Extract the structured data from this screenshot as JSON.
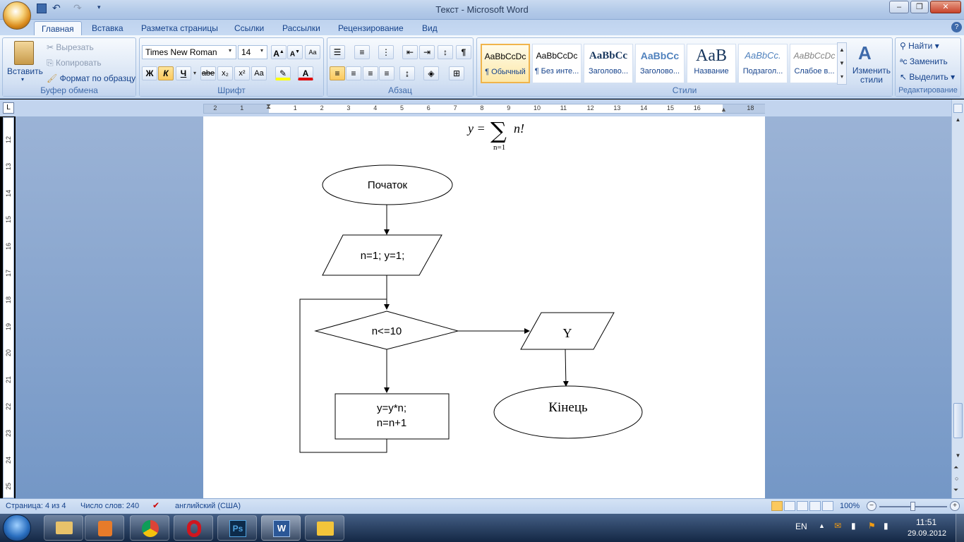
{
  "window": {
    "title": "Текст - Microsoft Word"
  },
  "tabs": [
    "Главная",
    "Вставка",
    "Разметка страницы",
    "Ссылки",
    "Рассылки",
    "Рецензирование",
    "Вид"
  ],
  "clipboard": {
    "paste": "Вставить",
    "cut": "Вырезать",
    "copy": "Копировать",
    "format": "Формат по образцу",
    "label": "Буфер обмена"
  },
  "font": {
    "name": "Times New Roman",
    "size": "14",
    "label": "Шрифт",
    "bold": "Ж",
    "italic": "К",
    "underline": "Ч",
    "strike": "abe",
    "sub": "x₂",
    "sup": "x²",
    "case": "Aa"
  },
  "paragraph": {
    "label": "Абзац"
  },
  "styles": {
    "label": "Стили",
    "items": [
      {
        "sample": "AaBbCcDc",
        "name": "¶ Обычный"
      },
      {
        "sample": "AaBbCcDc",
        "name": "¶ Без инте..."
      },
      {
        "sample": "AaBbCc",
        "name": "Заголово..."
      },
      {
        "sample": "AaBbCc",
        "name": "Заголово..."
      },
      {
        "sample": "AaB",
        "name": "Название"
      },
      {
        "sample": "AaBbCc.",
        "name": "Подзагол..."
      },
      {
        "sample": "AaBbCcDc",
        "name": "Слабое в..."
      }
    ],
    "change": "Изменить стили"
  },
  "editing": {
    "label": "Редактирование",
    "find": "Найти",
    "replace": "Заменить",
    "select": "Выделить"
  },
  "ruler": {
    "ticks": [
      "2",
      "1",
      "1",
      "2",
      "3",
      "4",
      "5",
      "6",
      "7",
      "8",
      "9",
      "10",
      "11",
      "12",
      "13",
      "14",
      "15",
      "16",
      "18"
    ],
    "vticks": [
      "12",
      "13",
      "14",
      "15",
      "16",
      "17",
      "18",
      "19",
      "20",
      "21",
      "22",
      "23",
      "24",
      "25"
    ]
  },
  "formula": {
    "lhs": "y =",
    "sum": "∑",
    "rhs": "n!",
    "sub": "n=1"
  },
  "flowchart": {
    "start": "Початок",
    "input": "n=1; y=1;",
    "cond": "n<=10",
    "process_line1": "y=y*n;",
    "process_line2": "n=n+1",
    "output": "Y",
    "end": "Кінець"
  },
  "status": {
    "page": "Страница: 4 из 4",
    "words": "Число слов: 240",
    "lang": "английский (США)",
    "zoom": "100%"
  },
  "tray": {
    "lang": "EN",
    "time": "11:51",
    "date": "29.09.2012"
  }
}
